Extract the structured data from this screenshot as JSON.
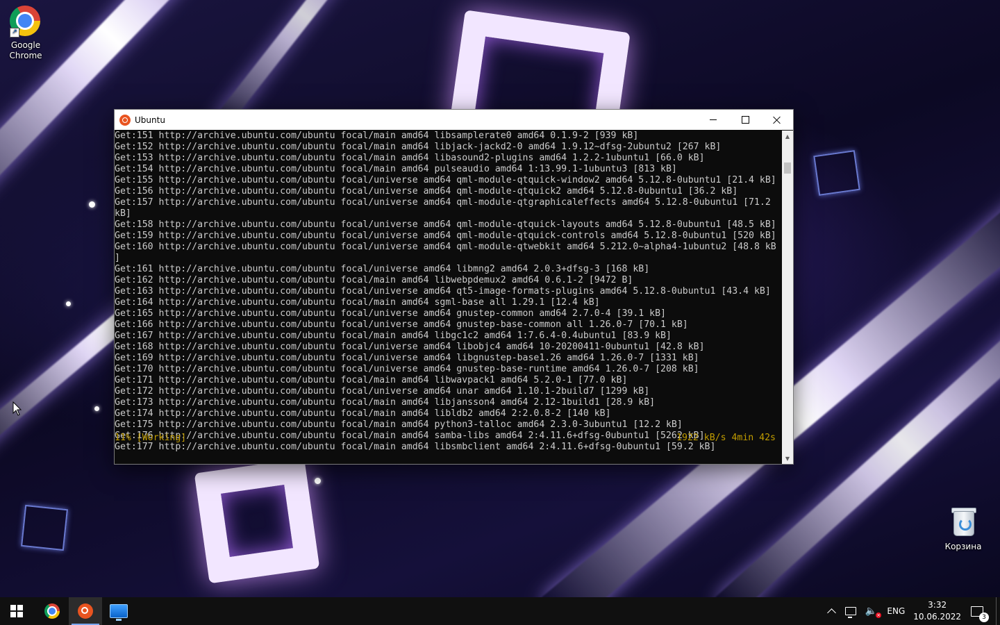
{
  "desktop": {
    "icons": [
      {
        "label": "Google\nChrome",
        "icon": "chrome-icon"
      },
      {
        "label": "Корзина",
        "icon": "recycle-bin-icon"
      }
    ]
  },
  "window": {
    "title": "Ubuntu",
    "icon": "ubuntu-icon",
    "controls": {
      "minimize": "minimize-icon",
      "maximize": "maximize-icon",
      "close": "close-icon"
    }
  },
  "terminal": {
    "lines": [
      "Get:151 http://archive.ubuntu.com/ubuntu focal/main amd64 libsamplerate0 amd64 0.1.9-2 [939 kB]",
      "Get:152 http://archive.ubuntu.com/ubuntu focal/main amd64 libjack-jackd2-0 amd64 1.9.12~dfsg-2ubuntu2 [267 kB]",
      "Get:153 http://archive.ubuntu.com/ubuntu focal/main amd64 libasound2-plugins amd64 1.2.2-1ubuntu1 [66.0 kB]",
      "Get:154 http://archive.ubuntu.com/ubuntu focal/main amd64 pulseaudio amd64 1:13.99.1-1ubuntu3 [813 kB]",
      "Get:155 http://archive.ubuntu.com/ubuntu focal/universe amd64 qml-module-qtquick-window2 amd64 5.12.8-0ubuntu1 [21.4 kB]",
      "Get:156 http://archive.ubuntu.com/ubuntu focal/universe amd64 qml-module-qtquick2 amd64 5.12.8-0ubuntu1 [36.2 kB]",
      "Get:157 http://archive.ubuntu.com/ubuntu focal/universe amd64 qml-module-qtgraphicaleffects amd64 5.12.8-0ubuntu1 [71.2",
      "kB]",
      "Get:158 http://archive.ubuntu.com/ubuntu focal/universe amd64 qml-module-qtquick-layouts amd64 5.12.8-0ubuntu1 [48.5 kB]",
      "Get:159 http://archive.ubuntu.com/ubuntu focal/universe amd64 qml-module-qtquick-controls amd64 5.12.8-0ubuntu1 [520 kB]",
      "Get:160 http://archive.ubuntu.com/ubuntu focal/universe amd64 qml-module-qtwebkit amd64 5.212.0~alpha4-1ubuntu2 [48.8 kB",
      "]",
      "Get:161 http://archive.ubuntu.com/ubuntu focal/universe amd64 libmng2 amd64 2.0.3+dfsg-3 [168 kB]",
      "Get:162 http://archive.ubuntu.com/ubuntu focal/main amd64 libwebpdemux2 amd64 0.6.1-2 [9472 B]",
      "Get:163 http://archive.ubuntu.com/ubuntu focal/universe amd64 qt5-image-formats-plugins amd64 5.12.8-0ubuntu1 [43.4 kB]",
      "Get:164 http://archive.ubuntu.com/ubuntu focal/main amd64 sgml-base all 1.29.1 [12.4 kB]",
      "Get:165 http://archive.ubuntu.com/ubuntu focal/universe amd64 gnustep-common amd64 2.7.0-4 [39.1 kB]",
      "Get:166 http://archive.ubuntu.com/ubuntu focal/universe amd64 gnustep-base-common all 1.26.0-7 [70.1 kB]",
      "Get:167 http://archive.ubuntu.com/ubuntu focal/main amd64 libgc1c2 amd64 1:7.6.4-0.4ubuntu1 [83.9 kB]",
      "Get:168 http://archive.ubuntu.com/ubuntu focal/universe amd64 libobjc4 amd64 10-20200411-0ubuntu1 [42.8 kB]",
      "Get:169 http://archive.ubuntu.com/ubuntu focal/universe amd64 libgnustep-base1.26 amd64 1.26.0-7 [1331 kB]",
      "Get:170 http://archive.ubuntu.com/ubuntu focal/universe amd64 gnustep-base-runtime amd64 1.26.0-7 [208 kB]",
      "Get:171 http://archive.ubuntu.com/ubuntu focal/main amd64 libwavpack1 amd64 5.2.0-1 [77.0 kB]",
      "Get:172 http://archive.ubuntu.com/ubuntu focal/universe amd64 unar amd64 1.10.1-2build7 [1299 kB]",
      "Get:173 http://archive.ubuntu.com/ubuntu focal/main amd64 libjansson4 amd64 2.12-1build1 [28.9 kB]",
      "Get:174 http://archive.ubuntu.com/ubuntu focal/main amd64 libldb2 amd64 2:2.0.8-2 [140 kB]",
      "Get:175 http://archive.ubuntu.com/ubuntu focal/main amd64 python3-talloc amd64 2.3.0-3ubuntu1 [12.2 kB]",
      "Get:176 http://archive.ubuntu.com/ubuntu focal/main amd64 samba-libs amd64 2:4.11.6+dfsg-0ubuntu1 [5262 kB]",
      "Get:177 http://archive.ubuntu.com/ubuntu focal/main amd64 libsmbclient amd64 2:4.11.6+dfsg-0ubuntu1 [59.2 kB]"
    ],
    "status_left": "11% [Working]",
    "status_right": "1922 kB/s 4min 42s",
    "status_color": "#c19c00",
    "text_color": "#cccccc",
    "background": "#0c0c0c"
  },
  "taskbar": {
    "buttons": [
      {
        "icon": "windows-start-icon"
      },
      {
        "icon": "chrome-icon"
      },
      {
        "icon": "ubuntu-icon"
      },
      {
        "icon": "remote-desktop-icon"
      }
    ],
    "tray": {
      "language": "ENG",
      "time": "3:32",
      "date": "10.06.2022",
      "notification_count": "3"
    }
  }
}
